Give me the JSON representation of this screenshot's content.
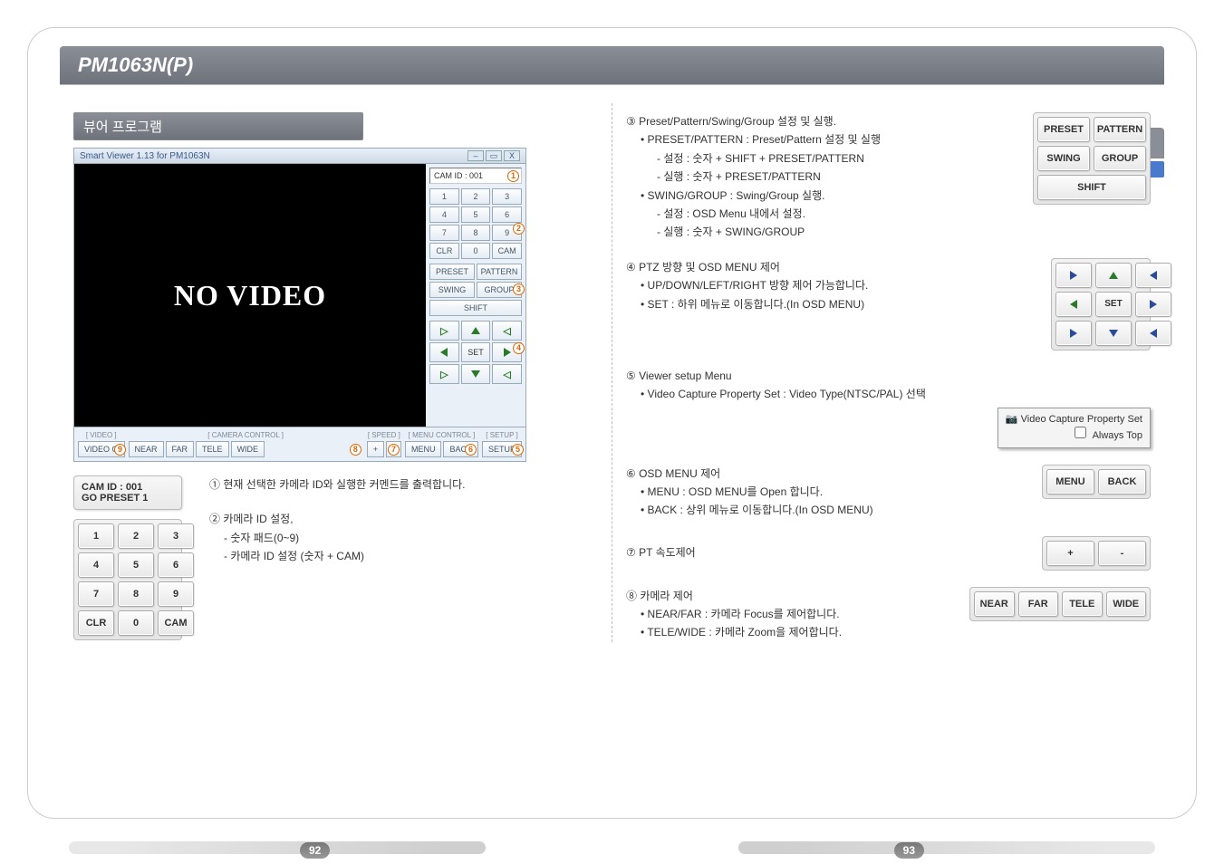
{
  "header": {
    "model": "PM1063N(P)"
  },
  "right_tab": "뷰어 프로그램",
  "left": {
    "section_title": "뷰어 프로그램",
    "app": {
      "title": "Smart Viewer 1.13 for PM1063N",
      "no_video": "NO VIDEO",
      "cam_id_label": "CAM ID : 001",
      "keypad": [
        "1",
        "2",
        "3",
        "4",
        "5",
        "6",
        "7",
        "8",
        "9",
        "CLR",
        "0",
        "CAM"
      ],
      "preset": "PRESET",
      "pattern": "PATTERN",
      "swing": "SWING",
      "group": "GROUP",
      "shift": "SHIFT",
      "set": "SET",
      "bottom": {
        "video_label": "[ VIDEO ]",
        "video_btn": "VIDEO O",
        "camera_label": "[ CAMERA CONTROL ]",
        "camera_btns": [
          "NEAR",
          "FAR",
          "TELE",
          "WIDE"
        ],
        "speed_label": "[ SPEED ]",
        "speed_btns": [
          "+",
          "-"
        ],
        "menu_label": "[ MENU CONTROL ]",
        "menu_btns": [
          "MENU",
          "BACK"
        ],
        "setup_label": "[ SETUP ]",
        "setup_btn": "SETUP"
      }
    },
    "lower": {
      "camid_panel": {
        "line1": "CAM ID  : 001",
        "line2": "GO PRESET  1"
      },
      "keypad": [
        "1",
        "2",
        "3",
        "4",
        "5",
        "6",
        "7",
        "8",
        "9",
        "CLR",
        "0",
        "CAM"
      ],
      "desc1": "① 현재 선택한 카메라 ID와 실행한 커멘드를 출력합니다.",
      "desc2_title": "② 카메라 ID 설정,",
      "desc2_l1": "- 숫자 패드(0~9)",
      "desc2_l2": "- 카메라 ID 설정 (숫자 + CAM)"
    }
  },
  "right": {
    "s3": {
      "title": "③ Preset/Pattern/Swing/Group 설정 및 실행.",
      "l1": "• PRESET/PATTERN : Preset/Pattern 설정 및 실행",
      "l2": "- 설정 : 숫자 + SHIFT + PRESET/PATTERN",
      "l3": "- 실행 : 숫자 + PRESET/PATTERN",
      "l4": "• SWING/GROUP : Swing/Group 실행.",
      "l5": "- 설정 : OSD Menu 내에서 설정.",
      "l6": "- 실행 : 숫자 + SWING/GROUP",
      "panel": {
        "preset": "PRESET",
        "pattern": "PATTERN",
        "swing": "SWING",
        "group": "GROUP",
        "shift": "SHIFT"
      }
    },
    "s4": {
      "title": "④ PTZ 방향 및 OSD MENU 제어",
      "l1": "• UP/DOWN/LEFT/RIGHT 방향 제어 가능합니다.",
      "l2": "• SET : 하위 메뉴로 이동합니다.(In OSD MENU)",
      "set": "SET"
    },
    "s5": {
      "title": "⑤ Viewer setup Menu",
      "l1": "•  Video Capture Property Set : Video Type(NTSC/PAL) 선택",
      "popup_l1": "Video Capture Property Set",
      "popup_l2": "Always Top"
    },
    "s6": {
      "title": "⑥ OSD MENU 제어",
      "l1": "• MENU : OSD MENU를 Open 합니다.",
      "l2": "• BACK  : 상위 메뉴로 이동합니다.(In OSD MENU)",
      "menu": "MENU",
      "back": "BACK"
    },
    "s7": {
      "title": "⑦ PT 속도제어",
      "plus": "+",
      "minus": "-"
    },
    "s8": {
      "title": "⑧ 카메라 제어",
      "l1": "• NEAR/FAR : 카메라 Focus를 제어합니다.",
      "l2": "• TELE/WIDE : 카메라 Zoom을 제어합니다.",
      "near": "NEAR",
      "far": "FAR",
      "tele": "TELE",
      "wide": "WIDE"
    }
  },
  "pages": {
    "left": "92",
    "right": "93"
  }
}
